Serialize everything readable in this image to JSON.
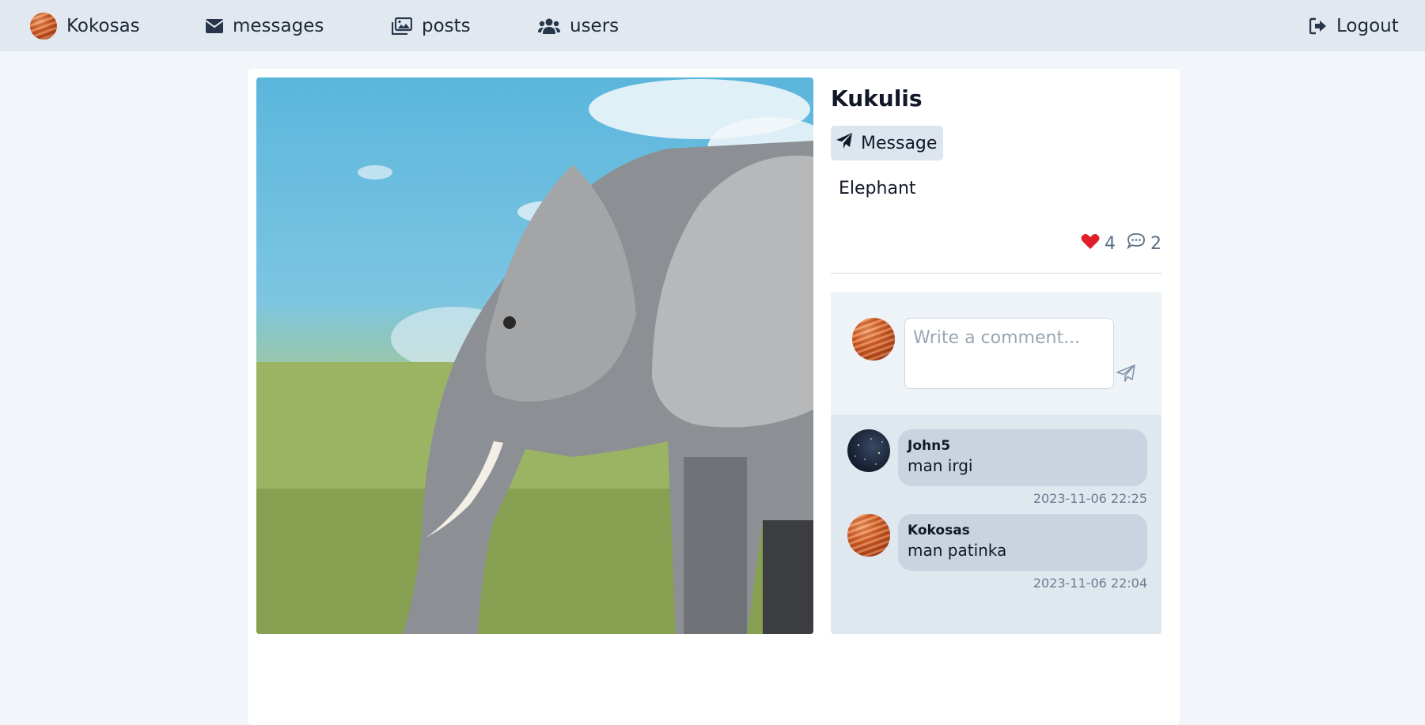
{
  "nav": {
    "profile_name": "Kokosas",
    "messages_label": "messages",
    "posts_label": "posts",
    "users_label": "users",
    "logout_label": "Logout"
  },
  "post": {
    "author": "Kukulis",
    "message_button_label": "Message",
    "caption": "Elephant",
    "likes_count": "4",
    "comments_count": "2"
  },
  "comment_form": {
    "placeholder": "Write a comment..."
  },
  "comments": [
    {
      "user": "John5",
      "text": "man irgi",
      "timestamp": "2023-11-06 22:25"
    },
    {
      "user": "Kokosas",
      "text": "man patinka",
      "timestamp": "2023-11-06 22:04"
    }
  ],
  "colors": {
    "navbar_bg": "#e1e8f0",
    "page_bg": "#f2f6fa",
    "heart": "#e11d2a",
    "comment_bubble": "#c9d4e0"
  },
  "icons": {
    "messages": "envelope-icon",
    "posts": "images-icon",
    "users": "users-icon",
    "logout": "sign-out-icon",
    "message_button": "paper-plane-icon",
    "likes": "heart-icon",
    "comments": "comment-icon",
    "send": "send-icon"
  }
}
